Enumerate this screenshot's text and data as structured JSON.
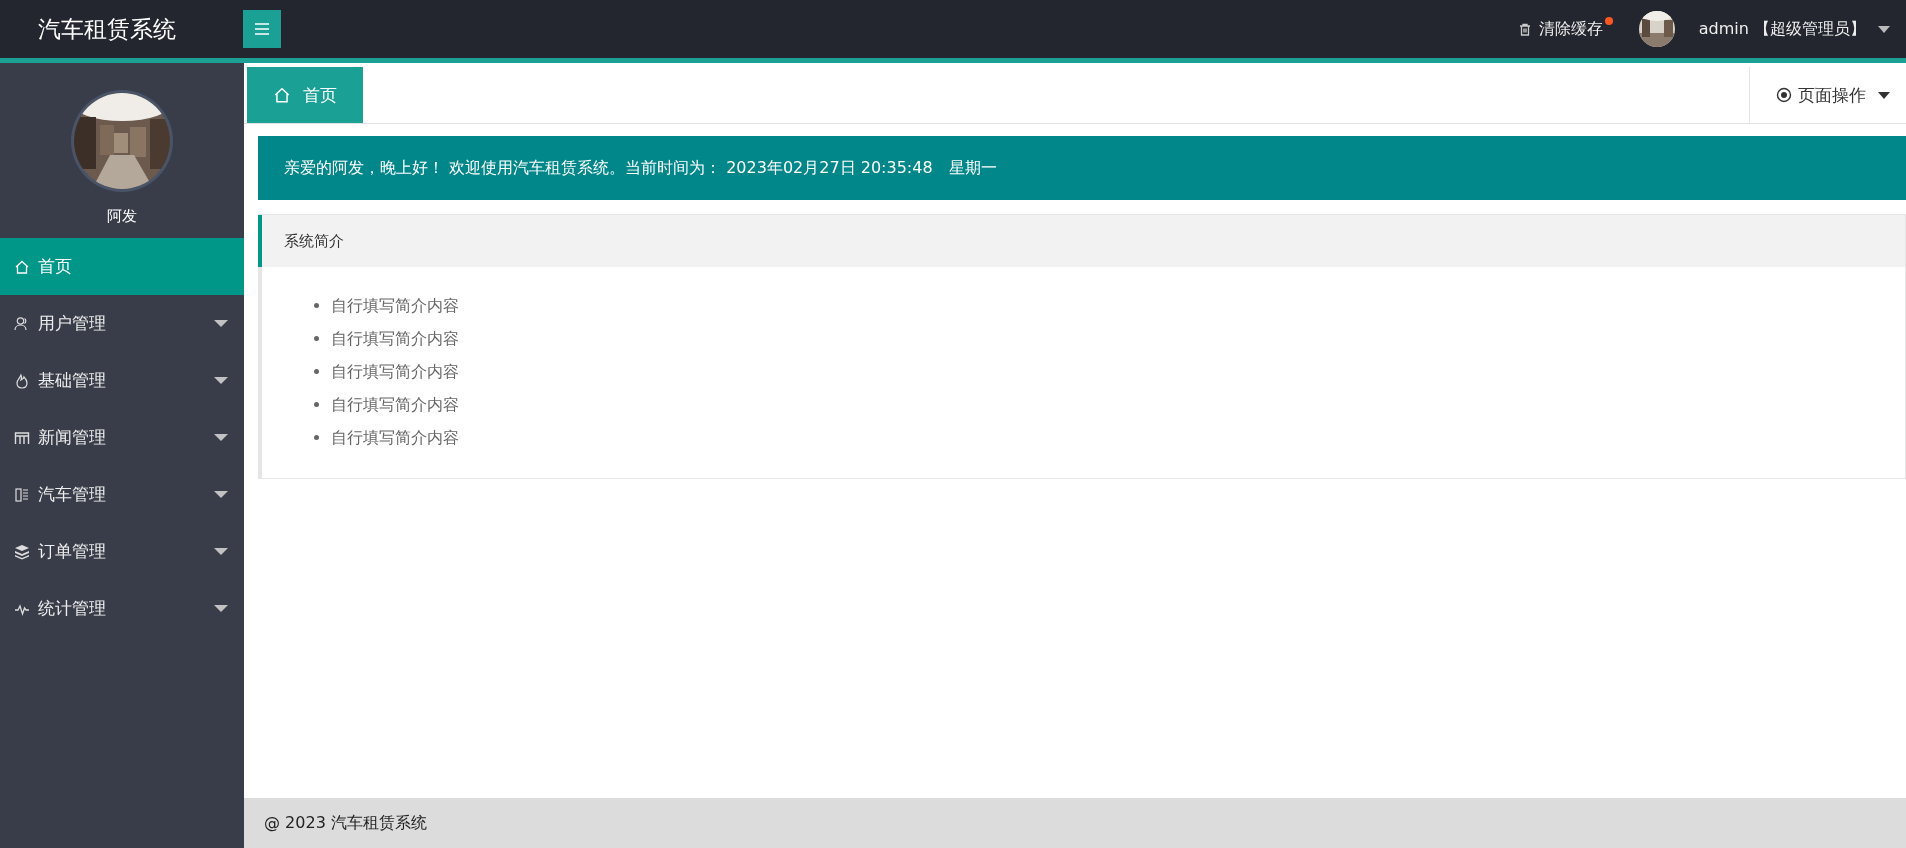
{
  "header": {
    "title": "汽车租赁系统",
    "clear_cache": "清除缓存",
    "clear_cache_badge": true,
    "user": "admin",
    "role": "【超级管理员】"
  },
  "sidebar": {
    "user_name": "阿发",
    "items": [
      {
        "label": "首页",
        "selected": true,
        "has_submenu": false
      },
      {
        "label": "用户管理",
        "selected": false,
        "has_submenu": true
      },
      {
        "label": "基础管理",
        "selected": false,
        "has_submenu": true
      },
      {
        "label": "新闻管理",
        "selected": false,
        "has_submenu": true
      },
      {
        "label": "汽车管理",
        "selected": false,
        "has_submenu": true
      },
      {
        "label": "订单管理",
        "selected": false,
        "has_submenu": true
      },
      {
        "label": "统计管理",
        "selected": false,
        "has_submenu": true
      }
    ]
  },
  "tabs": [
    {
      "label": "首页",
      "selected": true
    }
  ],
  "page_actions": "页面操作",
  "welcome": "亲爱的阿发，晚上好！ 欢迎使用汽车租赁系统。当前时间为： 2023年02月27日 20:35:48　星期一",
  "intro": {
    "title": "系统简介",
    "items": [
      "自行填写简介内容",
      "自行填写简介内容",
      "自行填写简介内容",
      "自行填写简介内容",
      "自行填写简介内容"
    ]
  },
  "footer": "@ 2023 汽车租赁系统"
}
